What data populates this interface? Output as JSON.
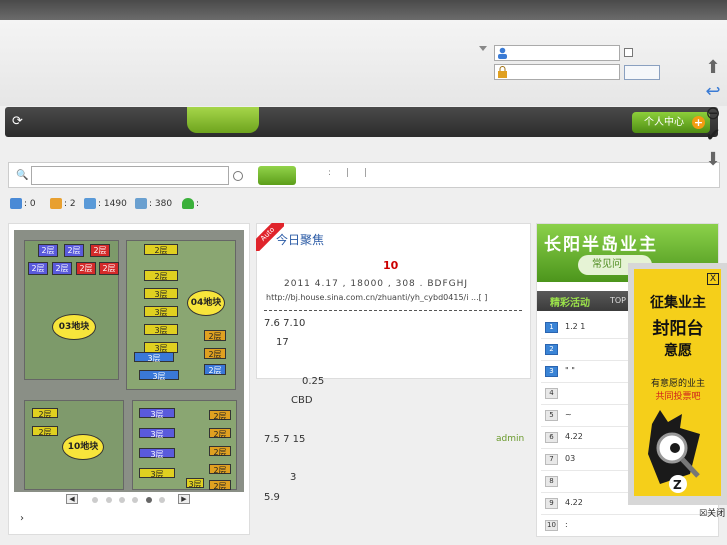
{
  "nav": {
    "personal_center": "个人中心",
    "plus": "+"
  },
  "search": {
    "separator1": ":",
    "separator2": "|",
    "separator3": "|"
  },
  "stats": [
    {
      "icon": "chart-icon",
      "value": ": 0"
    },
    {
      "icon": "edit-icon",
      "value": ": 2"
    },
    {
      "icon": "document-icon",
      "value": ": 1490"
    },
    {
      "icon": "users-icon",
      "value": ": 380"
    },
    {
      "icon": "user-online-icon",
      "value": ":"
    }
  ],
  "map": {
    "blocks_2f": [
      "2层",
      "2层",
      "2层",
      "2层",
      "2层",
      "2层",
      "2层",
      "2层",
      "2层",
      "2层",
      "2层",
      "2层",
      "2层",
      "2层",
      "2层",
      "2层",
      "2层",
      "2层",
      "2层"
    ],
    "blocks_3f": [
      "3层",
      "3层",
      "3层",
      "3层",
      "3层",
      "3层",
      "3层",
      "3层",
      "3层",
      "3层",
      "3层"
    ],
    "zones": [
      "03地块",
      "04地块",
      "10地块"
    ],
    "caption": "›"
  },
  "focus": {
    "ribbon": "Auto",
    "title": "今日聚焦",
    "headline_num": "10",
    "line1": "2011  4.17       ,  18000 ,  308 .  BDFGHJ",
    "line2": "http://bj.house.sina.com.cn/zhuanti/yh_cybd0415/i ...[ ]",
    "texts": [
      "7.6  7.10",
      "17",
      "0.25",
      "CBD",
      "7.5    7     15",
      "3",
      "5.9"
    ],
    "admin": "admin"
  },
  "banner": {
    "title": "长阳半岛业主",
    "sub": "常见问"
  },
  "activity": {
    "title": "精彩活动",
    "top": "TOP"
  },
  "ranking": [
    {
      "n": "1",
      "text": "1.2         1"
    },
    {
      "n": "2",
      "text": ""
    },
    {
      "n": "3",
      "text": "\"   \""
    },
    {
      "n": "4",
      "text": ""
    },
    {
      "n": "5",
      "text": "~"
    },
    {
      "n": "6",
      "text": "4.22"
    },
    {
      "n": "7",
      "text": "03"
    },
    {
      "n": "8",
      "text": ""
    },
    {
      "n": "9",
      "text": "4.22"
    },
    {
      "n": "10",
      "text": ":"
    }
  ],
  "popup": {
    "close": "X",
    "t1": "征集业主",
    "t2": "封阳台",
    "t3": "意愿",
    "s1": "有意愿的业主",
    "s2": "共同投票吧",
    "close_label": "关闭"
  },
  "colors": {
    "accent_green": "#6ea41e",
    "link_blue": "#2a5aa5",
    "red": "#c00"
  }
}
